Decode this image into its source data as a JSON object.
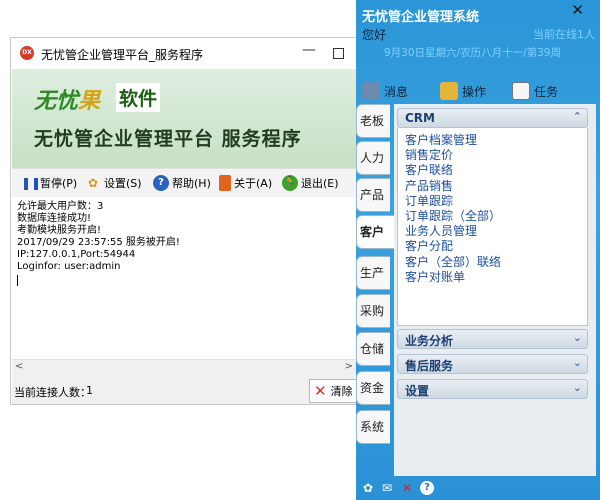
{
  "server": {
    "title": "无忧管企业管理平台_服务程序",
    "app_icon_text": "DX",
    "minimize": "—",
    "banner": {
      "logo_part1": "无忧",
      "logo_part2": "果",
      "logo_soft": "软件",
      "title": "无忧管企业管理平台 服务程序"
    },
    "toolbar": {
      "pause": "暂停(P)",
      "settings": "设置(S)",
      "help": "帮助(H)",
      "about": "关于(A)",
      "exit": "退出(E)"
    },
    "log": [
      "允许最大用户数：3",
      "数据库连接成功!",
      "考勤模块服务开启!",
      "2017/09/29 23:57:55 服务被开启!",
      "IP:127.0.0.1,Port:54944",
      "Loginfor: user:admin"
    ],
    "status": {
      "connections_label": "当前连接人数：",
      "connections_value": "1",
      "clear": "清除"
    }
  },
  "crm": {
    "title": "无忧管企业管理系统",
    "close": "✕",
    "greeting": "您好",
    "online": "当前在线1人",
    "date": "9月30日星期六/农历八月十一/第39周",
    "tabs": {
      "messages": "消息",
      "operations": "操作",
      "tasks": "任务"
    },
    "side_tabs": [
      "老板",
      "人力",
      "产品",
      "客户",
      "生产",
      "采购",
      "仓储",
      "资金",
      "系统"
    ],
    "active_side_tab": "客户",
    "sections": {
      "crm": {
        "title": "CRM",
        "items": [
          "客户档案管理",
          "销售定价",
          "客户联络",
          "产品销售",
          "订单跟踪",
          "订单跟踪（全部）",
          "业务人员管理",
          "客户分配",
          "客户（全部）联络",
          "客户对账单"
        ]
      },
      "analysis": "业务分析",
      "aftersales": "售后服务",
      "settings": "设置"
    }
  }
}
